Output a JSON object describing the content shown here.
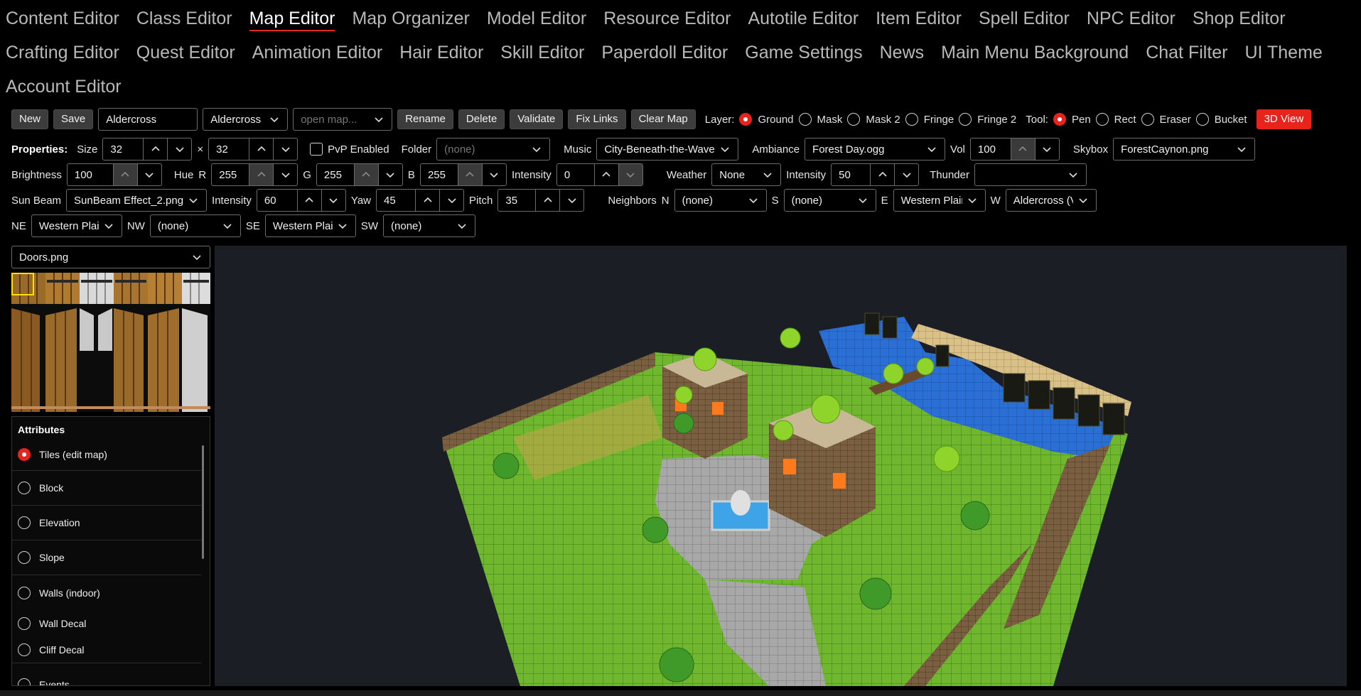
{
  "nav": {
    "row1": [
      "Content Editor",
      "Class Editor",
      "Map Editor",
      "Map Organizer",
      "Model Editor",
      "Resource Editor",
      "Autotile Editor",
      "Item Editor",
      "Spell Editor",
      "NPC Editor",
      "Shop Editor"
    ],
    "row2": [
      "Crafting Editor",
      "Quest Editor",
      "Animation Editor",
      "Hair Editor",
      "Skill Editor",
      "Paperdoll Editor",
      "Game Settings",
      "News",
      "Main Menu Background",
      "Chat Filter",
      "UI Theme"
    ],
    "row3": [
      "Account Editor"
    ],
    "active": "Map Editor"
  },
  "toolbar": {
    "new_label": "New",
    "save_label": "Save",
    "map_name": "Aldercross",
    "map_select": "Aldercross",
    "open_map_placeholder": "open map...",
    "rename_label": "Rename",
    "delete_label": "Delete",
    "validate_label": "Validate",
    "fix_links_label": "Fix Links",
    "clear_map_label": "Clear Map",
    "layer_label": "Layer:",
    "layers": [
      "Ground",
      "Mask",
      "Mask 2",
      "Fringe",
      "Fringe 2"
    ],
    "active_layer": "Ground",
    "tool_label": "Tool:",
    "tools": [
      "Pen",
      "Rect",
      "Eraser",
      "Bucket"
    ],
    "active_tool": "Pen",
    "view3d_label": "3D View"
  },
  "properties": {
    "title": "Properties:",
    "size_label": "Size",
    "width": "32",
    "times": "×",
    "height": "32",
    "pvp_label": "PvP Enabled",
    "folder_label": "Folder",
    "folder_value": "(none)",
    "music_label": "Music",
    "music_value": "City-Beneath-the-Wave",
    "ambiance_label": "Ambiance",
    "ambiance_value": "Forest Day.ogg",
    "vol_label": "Vol",
    "vol_value": "100",
    "skybox_label": "Skybox",
    "skybox_value": "ForestCaynon.png"
  },
  "lighting": {
    "brightness_label": "Brightness",
    "brightness": "100",
    "hue_label": "Hue",
    "r_label": "R",
    "r": "255",
    "g_label": "G",
    "g": "255",
    "b_label": "B",
    "b": "255",
    "intensity_label": "Intensity",
    "intensity": "0",
    "weather_label": "Weather",
    "weather_value": "None",
    "weather_intensity_label": "Intensity",
    "weather_intensity": "50",
    "thunder_label": "Thunder",
    "thunder_value": ""
  },
  "sunbeam": {
    "label": "Sun Beam",
    "value": "SunBeam Effect_2.png",
    "intensity_label": "Intensity",
    "intensity": "60",
    "yaw_label": "Yaw",
    "yaw": "45",
    "pitch_label": "Pitch",
    "pitch": "35"
  },
  "neighbors": {
    "label": "Neighbors",
    "n_label": "N",
    "n": "(none)",
    "s_label": "S",
    "s": "(none)",
    "e_label": "E",
    "e": "Western Plair",
    "w_label": "W",
    "w": "Aldercross (V",
    "ne_label": "NE",
    "ne": "Western Plair",
    "nw_label": "NW",
    "nw": "(none)",
    "se_label": "SE",
    "se": "Western Plair",
    "sw_label": "SW",
    "sw": "(none)"
  },
  "tileset": {
    "value": "Doors.png"
  },
  "attributes": {
    "title": "Attributes",
    "items": [
      "Tiles (edit map)",
      "Block",
      "Elevation",
      "Slope",
      "Walls (indoor)",
      "Wall Decal",
      "Cliff Decal",
      "Events"
    ],
    "selected": "Tiles (edit map)"
  },
  "colors": {
    "accent": "#e8231b",
    "background": "#000000",
    "viewport": "#1c1e26"
  }
}
